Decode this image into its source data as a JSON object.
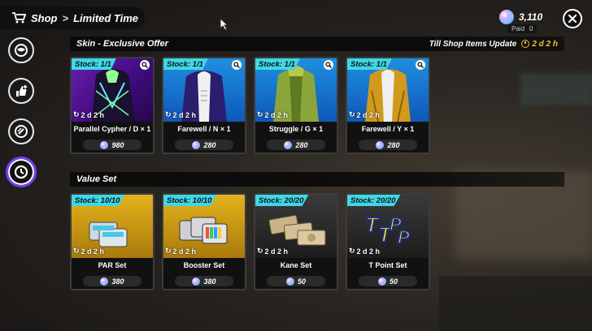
{
  "header": {
    "shop_label": "Shop",
    "separator": ">",
    "current_page": "Limited Time"
  },
  "currency": {
    "amount": "3,110",
    "paid_label": "Paid",
    "paid_amount": "0"
  },
  "sidebar": {
    "items": [
      {
        "icon": "sphere-icon"
      },
      {
        "icon": "thumbs-up-sparkle-icon"
      },
      {
        "icon": "coin-icon"
      },
      {
        "icon": "clock-icon",
        "active": true
      }
    ]
  },
  "skin_section": {
    "title": "Skin - Exclusive Offer",
    "timer_label": "Till Shop Items Update",
    "timer_value": "2 d 2 h",
    "items": [
      {
        "stock": "Stock: 1/1",
        "refresh": "2 d 2 h",
        "name": "Parallel Cypher / D × 1",
        "price": "980"
      },
      {
        "stock": "Stock: 1/1",
        "refresh": "2 d 2 h",
        "name": "Farewell / N × 1",
        "price": "280"
      },
      {
        "stock": "Stock: 1/1",
        "refresh": "2 d 2 h",
        "name": "Struggle / G × 1",
        "price": "280"
      },
      {
        "stock": "Stock: 1/1",
        "refresh": "2 d 2 h",
        "name": "Farewell / Y × 1",
        "price": "280"
      }
    ]
  },
  "value_section": {
    "title": "Value Set",
    "items": [
      {
        "stock": "Stock: 10/10",
        "refresh": "2 d 2 h",
        "name": "PAR Set",
        "price": "380"
      },
      {
        "stock": "Stock: 10/10",
        "refresh": "2 d 2 h",
        "name": "Booster Set",
        "price": "380"
      },
      {
        "stock": "Stock: 20/20",
        "refresh": "2 d 2 h",
        "name": "Kane Set",
        "price": "50"
      },
      {
        "stock": "Stock: 20/20",
        "refresh": "2 d 2 h",
        "name": "T Point Set",
        "price": "50"
      }
    ]
  },
  "colors": {
    "stock_badge": "#3fd7e6",
    "timer": "#f5c12e",
    "active_tab": "#7a3cff"
  }
}
